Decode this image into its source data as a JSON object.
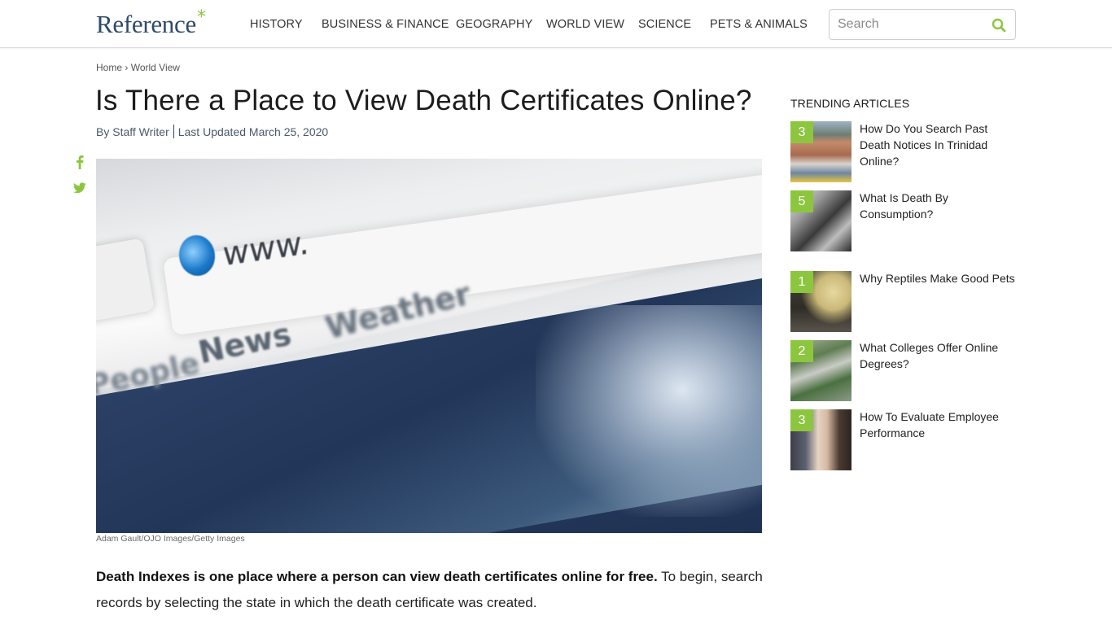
{
  "header": {
    "logo": "Reference",
    "logo_mark": "*",
    "nav": [
      {
        "label": "HISTORY"
      },
      {
        "label": "BUSINESS & FINANCE"
      },
      {
        "label": "GEOGRAPHY"
      },
      {
        "label": "WORLD VIEW"
      },
      {
        "label": "SCIENCE"
      },
      {
        "label": "PETS & ANIMALS"
      }
    ],
    "search": {
      "placeholder": "Search",
      "value": "",
      "icon": "search-icon"
    }
  },
  "colors": {
    "accent": "#8cc63f",
    "brand": "#2f4a68"
  },
  "breadcrumb": {
    "home": "Home",
    "separator": "›",
    "current": "World View"
  },
  "article": {
    "title": "Is There a Place to View Death Certificates Online?",
    "author": "By Staff Writer",
    "updated": "Last Updated March 25, 2020",
    "social": [
      "facebook-icon",
      "twitter-icon"
    ],
    "image_caption": "Adam Gault/OJO Images/Getty Images",
    "image_text": {
      "url": "www.",
      "tab1": "News",
      "tab2": "Weather",
      "tab3": "People"
    },
    "lead_bold": "Death Indexes is one place where a person can view death certificates online for free.",
    "lead_rest": " To begin, search records by selecting the state in which the death certificate was created."
  },
  "sidebar": {
    "title": "TRENDING ARTICLES",
    "items": [
      {
        "rank": "3",
        "title": "How Do You Search Past Death Notices In Trinidad Online?"
      },
      {
        "rank": "5",
        "title": "What Is Death By Consumption?"
      },
      {
        "rank": "1",
        "title": "Why Reptiles Make Good Pets"
      },
      {
        "rank": "2",
        "title": "What Colleges Offer Online Degrees?"
      },
      {
        "rank": "3",
        "title": "How To Evaluate Employee Performance"
      }
    ]
  }
}
